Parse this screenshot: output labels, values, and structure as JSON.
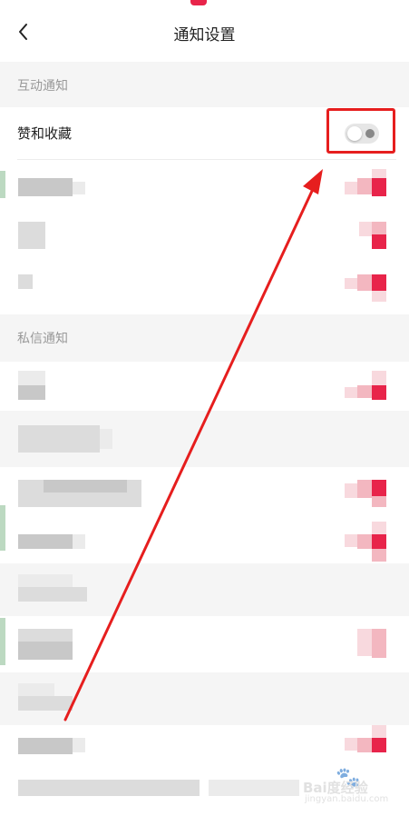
{
  "header": {
    "title": "通知设置"
  },
  "sections": [
    {
      "title": "互动通知"
    },
    {
      "title": "私信通知"
    }
  ],
  "rows": [
    {
      "label": "赞和收藏",
      "toggle_on": false
    }
  ],
  "colors": {
    "accent": "#e8244a",
    "annotation": "#e61e1e",
    "section_bg": "#f5f5f5"
  },
  "icons": {
    "back": "chevron-left-icon",
    "toggle": "toggle-switch-icon"
  },
  "watermark": {
    "brand": "Bai度经验",
    "url": "jingyan.baidu.com"
  }
}
